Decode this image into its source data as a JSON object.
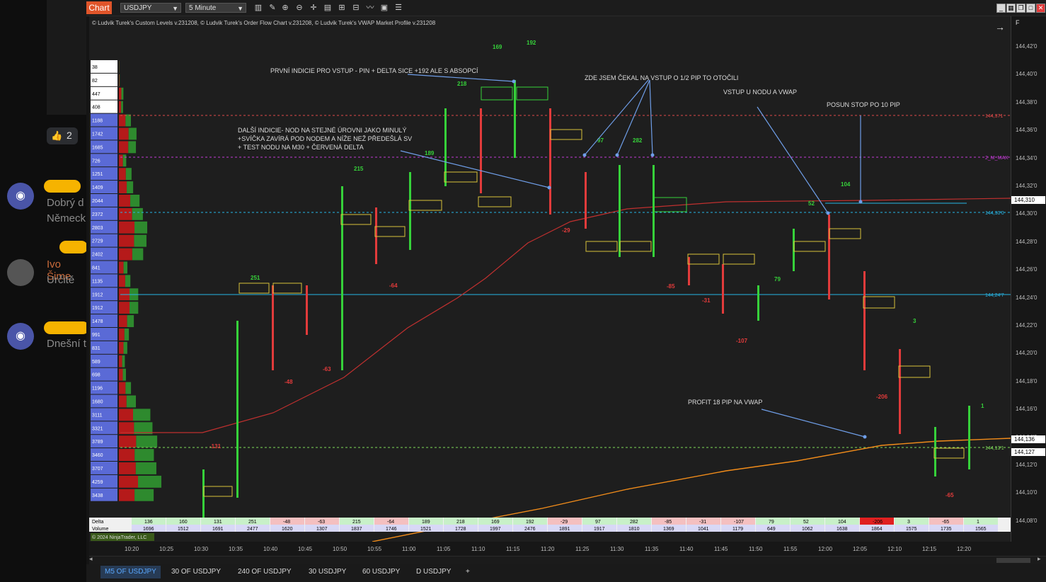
{
  "background_chat": {
    "reaction": "2",
    "line1": "Dobrý d",
    "line2": "Německ",
    "user": "Ivo Šime",
    "user_text": "Určitě",
    "line3": "Dnešní t"
  },
  "toolbar": {
    "tab": "Chart",
    "instrument": "USDJPY",
    "timeframe": "5 Minute"
  },
  "indicators_header": "© Ludvik Turek's Custom Levels v.231208, © Ludvik Turek's Order Flow Chart v.231208, © Ludvik Turek's VWAP Market Profile v.231208",
  "copyright": "© 2024 NinjaTrader, LLC",
  "annotations": [
    "PRVNÍ INDICIE PRO VSTUP - PIN + DELTA SICE +192 ALE S ABSOPCÍ",
    "DALŠÍ INDICIE- NOD NA STEJNÉ ÚROVNI JAKO MINULÝ",
    "+SVÍČKA ZAVÍRÁ POD NODEM A NÍŽE NEŽ PŘEDEŠLÁ SV",
    "+ TEST NODU NA M30 + ČERVENÁ DELTA",
    "ZDE JSEM ČEKAL NA  VSTUP O 1/2 PIP TO OTOČILI",
    "VSTUP U NODU A VWAP",
    "POSUN STOP PO 10 PIP",
    "PROFIT 18 PIP NA VWAP"
  ],
  "price_axis": [
    "144,42'0",
    "144,40'0",
    "144,38'0",
    "144,36'0",
    "144,34'0",
    "144,32'0",
    "144,30'0",
    "144,28'0",
    "144,26'0",
    "144,24'0",
    "144,22'0",
    "144,20'0",
    "144,18'0",
    "144,16'0",
    "144,14'0",
    "144,12'0",
    "144,10'0",
    "144,08'0"
  ],
  "price_labels": {
    "last1": "144,310",
    "last2": "144,136",
    "last3": "144,127",
    "line_red": "144,371",
    "line_magenta": "2_M_MAX",
    "line_cyan": "144,30'0",
    "line_cyan2": "144,24'7",
    "line_green": "144,13'1"
  },
  "time_axis": [
    "10:20",
    "10:25",
    "10:30",
    "10:35",
    "10:40",
    "10:45",
    "10:50",
    "10:55",
    "11:00",
    "11:05",
    "11:10",
    "11:15",
    "11:20",
    "11:25",
    "11:30",
    "11:35",
    "11:40",
    "11:45",
    "11:50",
    "11:55",
    "12:00",
    "12:05",
    "12:10",
    "12:15",
    "12:20"
  ],
  "profile_values": [
    "38",
    "82",
    "447",
    "408",
    "1188",
    "1742",
    "1685",
    "726",
    "1251",
    "1409",
    "2044",
    "2372",
    "2803",
    "2729",
    "2402",
    "841",
    "1135",
    "1912",
    "1912",
    "1478",
    "991",
    "831",
    "589",
    "698",
    "1196",
    "1680",
    "3111",
    "3321",
    "3789",
    "3460",
    "3707",
    "4259",
    "3438"
  ],
  "delta_label": "Delta",
  "volume_label": "Volume",
  "deltas": [
    "136",
    "160",
    "131",
    "251",
    "-48",
    "-63",
    "215",
    "-64",
    "189",
    "218",
    "169",
    "192",
    "-29",
    "97",
    "282",
    "-85",
    "-31",
    "-107",
    "79",
    "52",
    "104",
    "-206",
    "3",
    "-65",
    "1"
  ],
  "volumes": [
    "1696",
    "1512",
    "1691",
    "2477",
    "1620",
    "1307",
    "1837",
    "1746",
    "1521",
    "1728",
    "1997",
    "2476",
    "1891",
    "1917",
    "1810",
    "1369",
    "1041",
    "1179",
    "649",
    "1062",
    "1638",
    "1864",
    "1575",
    "1735",
    "1565"
  ],
  "bar_deltas": [
    {
      "label": "251"
    },
    {
      "label": "-131"
    },
    {
      "label": "-48"
    },
    {
      "label": "-63"
    },
    {
      "label": "215"
    },
    {
      "label": "-64"
    },
    {
      "label": "189"
    },
    {
      "label": "218"
    },
    {
      "label": "169"
    },
    {
      "label": "192"
    },
    {
      "label": "-29"
    },
    {
      "label": "97"
    },
    {
      "label": "282"
    },
    {
      "label": "-85"
    },
    {
      "label": "-31"
    },
    {
      "label": "-107"
    },
    {
      "label": "79"
    },
    {
      "label": "52"
    },
    {
      "label": "104"
    },
    {
      "label": "-206"
    },
    {
      "label": "3"
    },
    {
      "label": "-65"
    },
    {
      "label": "1"
    }
  ],
  "bottom_tabs": [
    "M5 OF USDJPY",
    "30 OF USDJPY",
    "240 OF USDJPY",
    "30 USDJPY",
    "60 USDJPY",
    "D USDJPY",
    "+"
  ],
  "colors": {
    "accent": "#e0552a",
    "tab_active": "#5aa8ff",
    "bull": "#36d13a",
    "bear": "#e23b3b",
    "vwap": "#f28c1a",
    "ma": "#c0302f",
    "cyan": "#27b7e6",
    "magenta": "#c43bd6"
  }
}
